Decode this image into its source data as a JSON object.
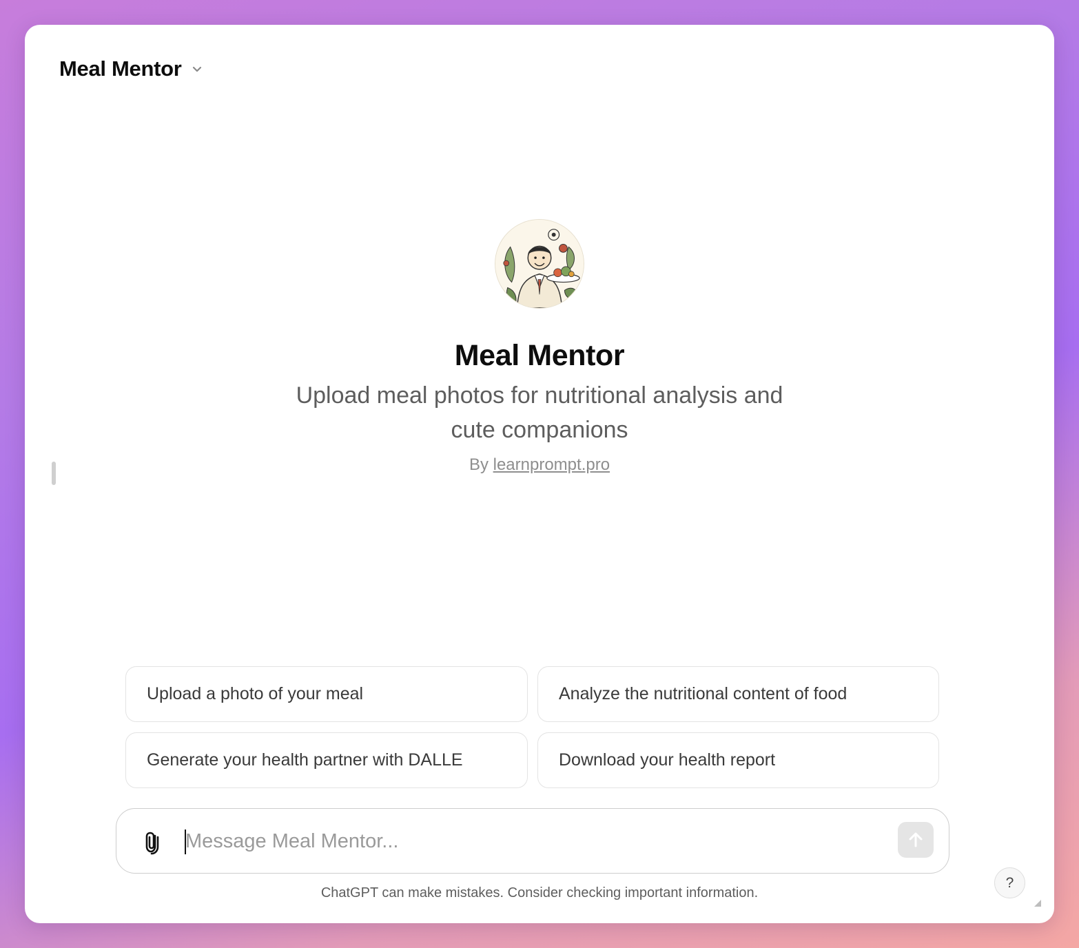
{
  "header": {
    "title": "Meal Mentor",
    "dropdown_icon": "chevron-down-icon"
  },
  "hero": {
    "avatar_icon": "nutritionist-chef-avatar",
    "title": "Meal Mentor",
    "description": "Upload meal photos for nutritional analysis and cute companions",
    "by_prefix": "By",
    "author": "learnprompt.pro"
  },
  "suggestions": [
    {
      "label": "Upload a photo of your meal"
    },
    {
      "label": "Analyze the nutritional content of food"
    },
    {
      "label": "Generate your health partner with DALLE"
    },
    {
      "label": "Download your health report"
    }
  ],
  "composer": {
    "placeholder": "Message Meal Mentor...",
    "attach_icon": "paperclip-icon",
    "send_icon": "arrow-up-icon"
  },
  "disclaimer": "ChatGPT can make mistakes. Consider checking important information.",
  "help": {
    "label": "?"
  },
  "colors": {
    "background_start": "#c77ddb",
    "background_end": "#f4a7a4",
    "send_button": "#e5e5e5"
  }
}
